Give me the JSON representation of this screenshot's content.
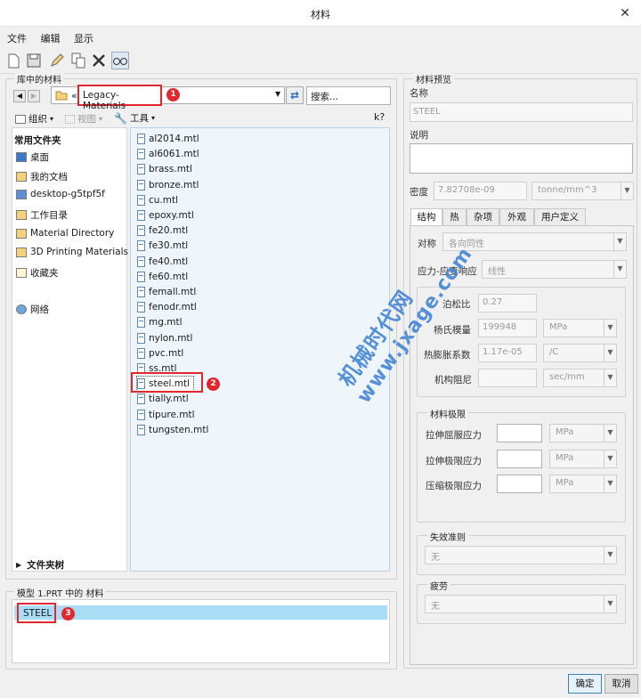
{
  "window": {
    "title": "材料",
    "close_glyph": "✕"
  },
  "menu": [
    "文件",
    "编辑",
    "显示"
  ],
  "library": {
    "group_label": "库中的材料",
    "path_prefix": "«",
    "path": "Legacy-Materials",
    "search_placeholder": "搜索...",
    "organize_label": "组织",
    "view_label": "视图",
    "tools_label": "工具",
    "help_glyph": "k?",
    "favorites_header": "常用文件夹",
    "favorites": [
      "桌面",
      "我的文档",
      "desktop-g5tpf5f",
      "工作目录",
      "Material Directory",
      "3D Printing Materials",
      "收藏夹"
    ],
    "network": "网络",
    "folder_tree": "文件夹树",
    "files": [
      "al2014.mtl",
      "al6061.mtl",
      "brass.mtl",
      "bronze.mtl",
      "cu.mtl",
      "epoxy.mtl",
      "fe20.mtl",
      "fe30.mtl",
      "fe40.mtl",
      "fe60.mtl",
      "femall.mtl",
      "fenodr.mtl",
      "mg.mtl",
      "nylon.mtl",
      "pvc.mtl",
      "ss.mtl",
      "steel.mtl",
      "tially.mtl",
      "tipure.mtl",
      "tungsten.mtl"
    ],
    "selected_file": "steel.mtl"
  },
  "model": {
    "group_label": "模型 1.PRT 中的 材料",
    "items": [
      "STEEL"
    ]
  },
  "badges": [
    "1",
    "2",
    "3"
  ],
  "preview": {
    "group_label": "材料预览",
    "name_label": "名称",
    "name_value": "STEEL",
    "desc_label": "说明",
    "density_label": "密度",
    "density_value": "7.82708e-09",
    "density_unit": "tonne/mm^3",
    "tabs": [
      "结构",
      "热",
      "杂项",
      "外观",
      "用户定义"
    ],
    "symmetry_label": "对称",
    "symmetry_value": "各向同性",
    "stress_label": "应力-应变响应",
    "stress_value": "线性",
    "poisson_label": "泊松比",
    "poisson_value": "0.27",
    "young_label": "杨氏模量",
    "young_value": "199948",
    "young_unit": "MPa",
    "thermal_label": "热膨胀系数",
    "thermal_value": "1.17e-05",
    "thermal_unit": "/C",
    "damping_label": "机构阻尼",
    "damping_unit": "sec/mm",
    "limits_label": "材料极限",
    "tensile_yield_label": "拉伸屈服应力",
    "tensile_ult_label": "拉伸极限应力",
    "compress_label": "压缩极限应力",
    "mpa": "MPa",
    "failure_label": "失效准则",
    "failure_value": "无",
    "fatigue_label": "疲劳",
    "fatigue_value": "无"
  },
  "buttons": {
    "ok": "确定",
    "cancel": "取消"
  },
  "watermark": [
    "机械时代网",
    "www.jxage.com"
  ],
  "colors": {
    "accent_red": "#e0282e",
    "selection_blue": "#a9dcf5",
    "file_bg": "#eef6fc"
  }
}
